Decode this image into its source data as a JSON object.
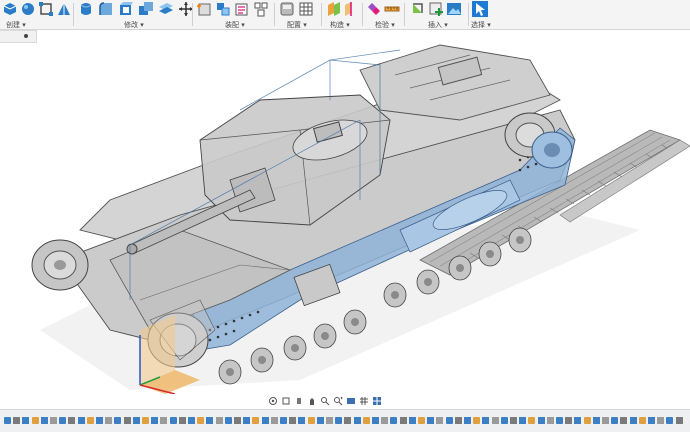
{
  "toolbar": {
    "groups": [
      {
        "label": "创建 ▾",
        "icons": [
          "create-box-icon",
          "create-sphere-icon",
          "create-corner-icon",
          "create-triangle-icon"
        ]
      },
      {
        "label": "修改 ▾",
        "icons": [
          "press-pull-icon",
          "fillet-icon",
          "shell-icon",
          "combine-icon",
          "move-icon"
        ]
      },
      {
        "label": "装配 ▾",
        "icons": [
          "new-component-icon",
          "joint-icon",
          "as-built-joint-icon",
          "rigid-group-icon"
        ]
      },
      {
        "label": "配置 ▾",
        "icons": [
          "configure-icon",
          "table-icon"
        ]
      },
      {
        "label": "构造 ▾",
        "icons": [
          "offset-plane-icon",
          "axis-icon",
          "point-icon"
        ]
      },
      {
        "label": "检验 ▾",
        "icons": [
          "measure-icon",
          "section-analysis-icon"
        ]
      },
      {
        "label": "插入 ▾",
        "icons": [
          "insert-derive-icon",
          "insert-image-icon"
        ]
      },
      {
        "label": "选择 ▾",
        "icons": [
          "select-arrow-icon"
        ]
      }
    ]
  },
  "navbar": {
    "icons": [
      "orbit-icon",
      "pan-icon",
      "look-at-icon",
      "zoom-icon",
      "zoom-window-icon",
      "display-settings-icon",
      "grid-icon",
      "viewports-icon"
    ]
  },
  "timeline": {
    "item_count": 74
  },
  "colors": {
    "accent": "#0696d7",
    "body": "#c8c8c8",
    "selection": "#8fb4d8"
  }
}
